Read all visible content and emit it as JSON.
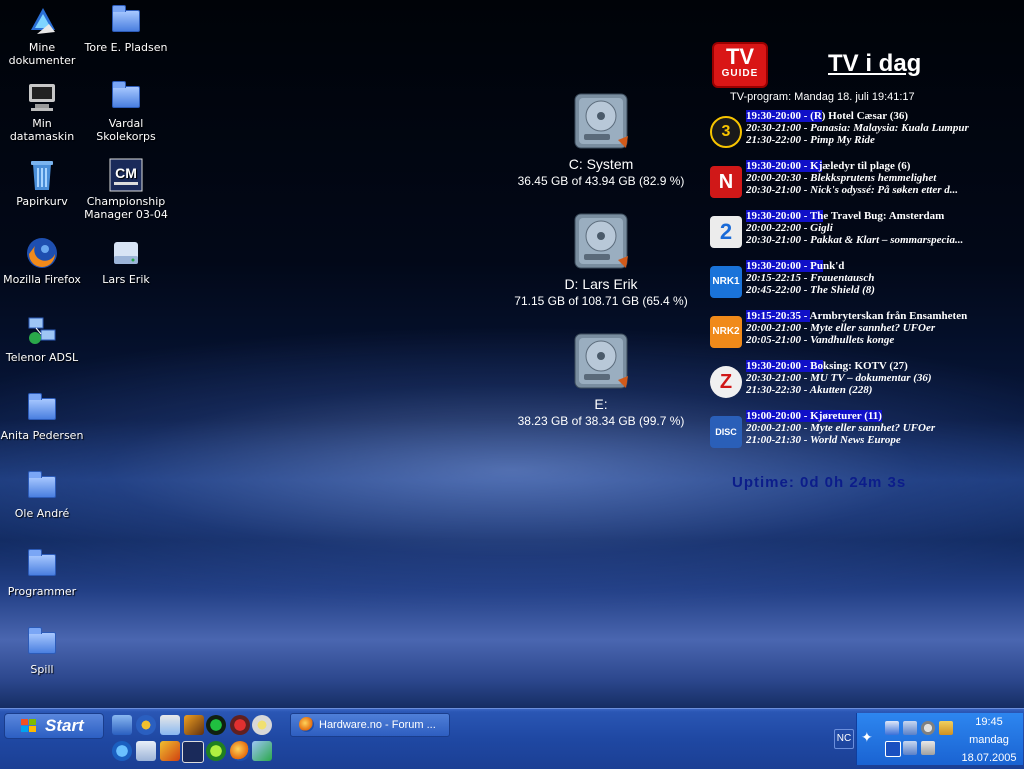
{
  "desktop_icons": [
    {
      "label": "Mine dokumenter",
      "icon": "my-documents-icon"
    },
    {
      "label": "Tore E. Pladsen",
      "icon": "folder-icon"
    },
    {
      "label": "Min datamaskin",
      "icon": "my-computer-icon"
    },
    {
      "label": "Vardal Skolekorps",
      "icon": "folder-icon"
    },
    {
      "label": "Papirkurv",
      "icon": "recycle-bin-icon"
    },
    {
      "label": "Championship Manager 03-04",
      "icon": "championship-manager-icon"
    },
    {
      "label": "Mozilla Firefox",
      "icon": "firefox-icon"
    },
    {
      "label": "Lars Erik",
      "icon": "drive-icon"
    },
    {
      "label": "Telenor ADSL",
      "icon": "network-icon"
    },
    {
      "label": "Anita Pedersen",
      "icon": "folder-icon"
    },
    {
      "label": "Ole André",
      "icon": "folder-icon"
    },
    {
      "label": "Programmer",
      "icon": "folder-icon"
    },
    {
      "label": "Spill",
      "icon": "folder-icon"
    }
  ],
  "drives": [
    {
      "name": "C:  System",
      "usage": "36.45 GB of 43.94 GB (82.9 %)"
    },
    {
      "name": "D: Lars Erik",
      "usage": "71.15 GB of 108.71 GB (65.4 %)"
    },
    {
      "name": "E:",
      "usage": "38.23 GB of 38.34 GB (99.7 %)"
    }
  ],
  "tvguide": {
    "logo_top": "TV",
    "logo_bottom": "GUIDE",
    "title": "TV i dag",
    "date": "TV-program: Mandag 18. juli 19:41:17",
    "channels": [
      {
        "logo": "3",
        "color": "#1a1a1a",
        "fg": "#f7c400",
        "hl": "19:30-20:00 - (R",
        "rest": ") Hotel Cæsar (36)",
        "p2": "20:30-21:00 - Panasia: Malaysia: Kuala Lumpur",
        "p3": "21:30-22:00 - Pimp My Ride"
      },
      {
        "logo": "N",
        "color": "#d01818",
        "fg": "#ffffff",
        "hl": "19:30-20:00 - Kj",
        "rest": "æledyr til plage (6)",
        "p2": "20:00-20:30 - Blekksprutens hemmelighet",
        "p3": "20:30-21:00 - Nick's odyssé: På søken etter d..."
      },
      {
        "logo": "2",
        "color": "#e8e8e8",
        "fg": "#1a6bd8",
        "hl": "19:30-20:00 - Th",
        "rest": "e Travel Bug: Amsterdam",
        "p2": "20:00-22:00 - Gigli",
        "p3": "20:30-21:00 - Pakkat & Klart – sommarspecia..."
      },
      {
        "logo": "NRK1",
        "color": "#1a73d9",
        "fg": "#ffffff",
        "hl": "19:30-20:00 - Pu",
        "rest": "nk'd",
        "p2": "20:15-22:15 - Frauentausch",
        "p3": "20:45-22:00 - The Shield (8)"
      },
      {
        "logo": "NRK2",
        "color": "#f08a1a",
        "fg": "#ffffff",
        "hl": "19:15-20:35 - ",
        "rest": "Armbryterskan från Ensamheten",
        "p2": "20:00-21:00 - Myte eller sannhet? UFOer",
        "p3": "20:05-21:00 - Vandhullets konge"
      },
      {
        "logo": "Z",
        "color": "#f0f0f0",
        "fg": "#d01818",
        "hl": "19:30-20:00 - Bo",
        "rest": "ksing: KOTV (27)",
        "p2": "20:30-21:00 - MU TV – dokumentar (36)",
        "p3": "21:30-22:30 - Akutten (228)"
      },
      {
        "logo": "DISC",
        "color": "#2a5fb8",
        "fg": "#ffffff",
        "hl": "19:00-20:00 - Kjøreturer (11)",
        "rest": "",
        "p2": "20:00-21:00 - Myte eller sannhet? UFOer",
        "p3": "21:00-21:30 - World News Europe"
      }
    ],
    "uptime": "Uptime: 0d 0h 24m 3s"
  },
  "taskbar": {
    "start_label": "Start",
    "task_label": "Hardware.no - Forum ...",
    "nc_label": "NC",
    "clock_time": "19:45",
    "clock_day": "mandag",
    "clock_date": "18.07.2005"
  }
}
